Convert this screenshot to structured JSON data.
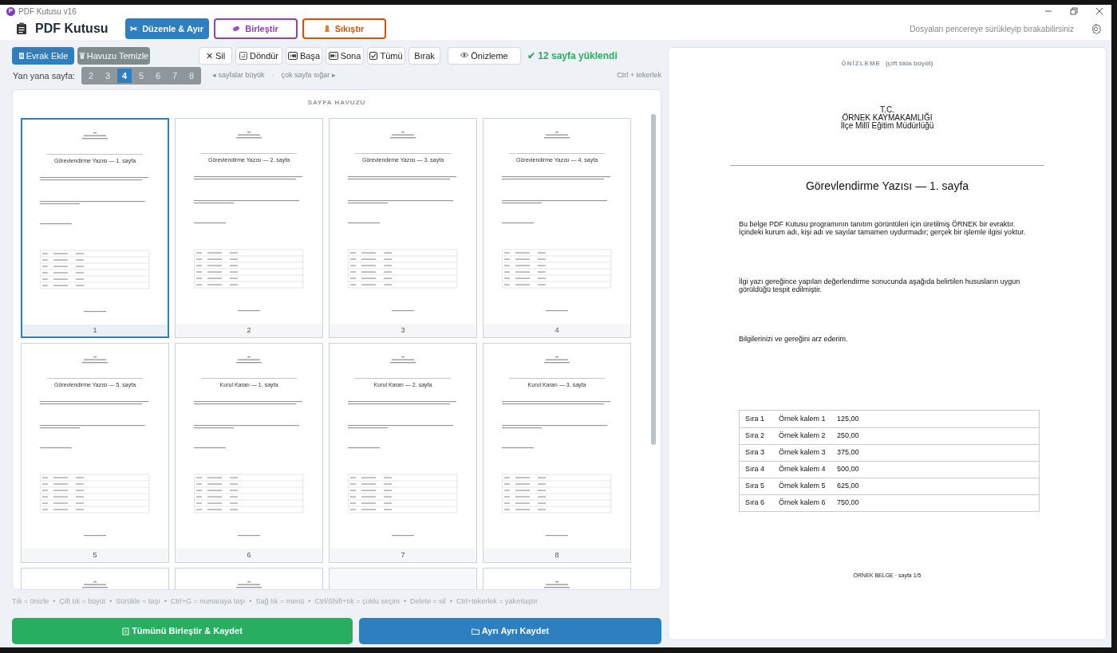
{
  "window": {
    "title": "PDF Kutusu v16",
    "icon_letter": "P"
  },
  "app": {
    "name": "PDF Kutusu"
  },
  "tabs": [
    {
      "label": "Düzenle & Ayır",
      "icon": "✂",
      "kind": "split",
      "selected": true
    },
    {
      "label": "Birleştir",
      "kind": "merge",
      "selected": false
    },
    {
      "label": "Sıkıştır",
      "kind": "compress",
      "selected": false
    }
  ],
  "drop_hint": "Dosyaları pencereye sürükleyip bırakabilirsiniz",
  "pool_buttons": [
    {
      "label": "Evrak Ekle",
      "kind": "add"
    },
    {
      "label": "Havuzu Temizle",
      "kind": "clear"
    }
  ],
  "tools": [
    {
      "label": "Sil",
      "kind": "delete",
      "icon": "✕"
    },
    {
      "label": "Döndür",
      "kind": "rotate"
    },
    {
      "label": "Başa",
      "kind": "first"
    },
    {
      "label": "Sona",
      "kind": "last"
    },
    {
      "label": "Tümü",
      "kind": "all"
    },
    {
      "label": "Bırak",
      "kind": "plain"
    },
    {
      "label": "Önizleme",
      "kind": "preview"
    }
  ],
  "status": "✔ 12 sayfa yüklendi",
  "per_row": {
    "label": "Yan yana sayfa:",
    "options": [
      {
        "label": "2",
        "selected": false
      },
      {
        "label": "3",
        "selected": false
      },
      {
        "label": "4",
        "selected": true
      },
      {
        "label": "5",
        "selected": false
      },
      {
        "label": "6",
        "selected": false
      },
      {
        "label": "7",
        "selected": false
      },
      {
        "label": "8",
        "selected": false
      }
    ]
  },
  "size_hints": [
    "◂ sayfalar büyük",
    "·",
    "çok sayfa sığar ▸"
  ],
  "zoom_hint": "Ctrl + tekerlek",
  "pool": {
    "title": "SAYFA HAVUZU",
    "pages": [
      {
        "kind": "doc",
        "title": "Görevlendirme Yazısı — 1. sayfa",
        "number": "1",
        "selected": true
      },
      {
        "kind": "doc",
        "title": "Görevlendirme Yazısı — 2. sayfa",
        "number": "2",
        "selected": false
      },
      {
        "kind": "doc",
        "title": "Görevlendirme Yazısı — 3. sayfa",
        "number": "3",
        "selected": false
      },
      {
        "kind": "doc",
        "title": "Görevlendirme Yazısı — 4. sayfa",
        "number": "4",
        "selected": false
      },
      {
        "kind": "doc",
        "title": "Görevlendirme Yazısı — 5. sayfa",
        "number": "5",
        "selected": false
      },
      {
        "kind": "doc",
        "title": "Kurul Kararı — 1. sayfa",
        "number": "6",
        "selected": false
      },
      {
        "kind": "doc",
        "title": "Kurul Kararı — 2. sayfa",
        "number": "7",
        "selected": false
      },
      {
        "kind": "doc",
        "title": "Kurul Kararı — 3. sayfa",
        "number": "8",
        "selected": false
      },
      {
        "kind": "partial",
        "selected": false
      },
      {
        "kind": "partial",
        "selected": false
      },
      {
        "kind": "blank",
        "selected": false
      },
      {
        "kind": "partial",
        "selected": false
      }
    ]
  },
  "hints": "Tık = önizle  •  Çift tık = büyüt  •  Sürükle = taşı  •  Ctrl+G = numaraya taşı  •  Sağ tık = menü  •  Ctrl/Shift+tık = çoklu seçim  •  Delete = sil  •  Ctrl+tekerlek = yakınlaştır",
  "actions": [
    {
      "label": "Tümünü Birleştir & Kaydet",
      "kind": "merge"
    },
    {
      "label": "Ayrı Ayrı Kaydet",
      "kind": "separate"
    }
  ],
  "preview": {
    "title": "ÖNİZLEME",
    "note": "(çift tıkla büyüt)",
    "header": [
      "T.C.",
      "ÖRNEK KAYMAKAMLIĞI",
      "İlçe Millî Eğitim Müdürlüğü"
    ],
    "doc_title": "Görevlendirme Yazısı — 1. sayfa",
    "paragraphs": [
      "Bu belge PDF Kutusu programının tanıtım görüntüleri için üretilmiş ÖRNEK bir evraktır. İçindeki kurum adı, kişi adı ve sayılar tamamen uydurmadır; gerçek bir işlemle ilgisi yoktur.",
      "İlgi yazı gereğince yapılan değerlendirme sonucunda aşağıda belirtilen hususların uygun görüldüğü tespit edilmiştir.",
      "Bilgilerinizi ve gereğini arz ederim."
    ],
    "table": [
      [
        "Sıra 1",
        "Örnek kalem 1",
        "125,00"
      ],
      [
        "Sıra 2",
        "Örnek kalem 2",
        "250,00"
      ],
      [
        "Sıra 3",
        "Örnek kalem 3",
        "375,00"
      ],
      [
        "Sıra 4",
        "Örnek kalem 4",
        "500,00"
      ],
      [
        "Sıra 5",
        "Örnek kalem 5",
        "625,00"
      ],
      [
        "Sıra 6",
        "Örnek kalem 6",
        "750,00"
      ]
    ],
    "footer": "ÖRNEK BELGE · sayfa 1/5"
  }
}
